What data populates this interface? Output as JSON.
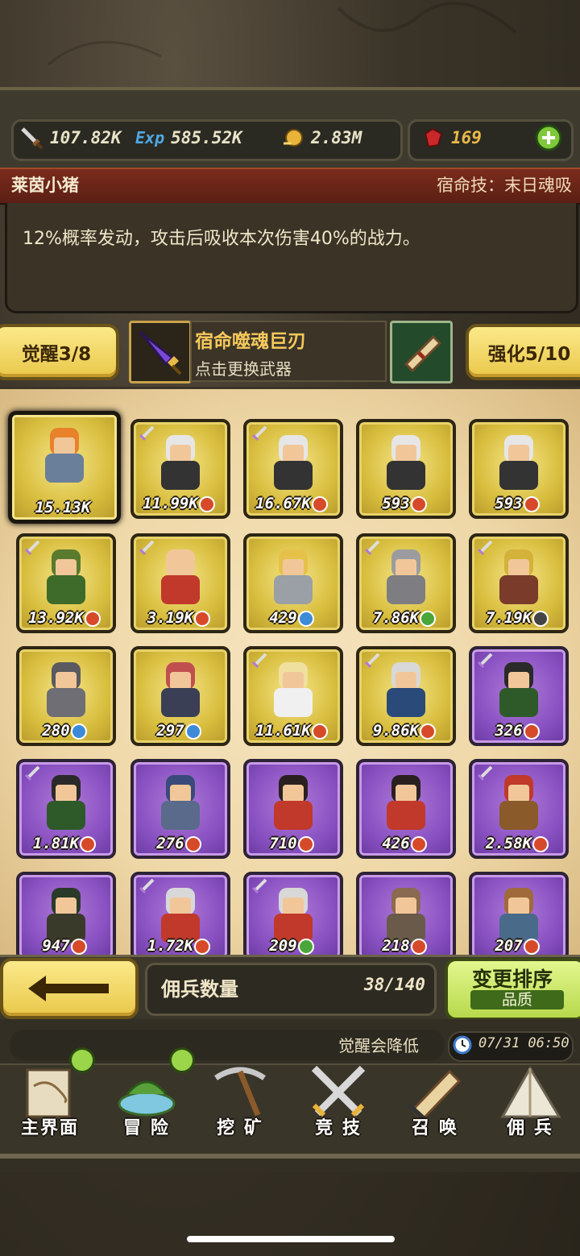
{
  "resources": {
    "attack": "107.82K",
    "exp_icon_label": "Exp",
    "exp": "585.52K",
    "gold": "2.83M",
    "gems": "169"
  },
  "hero": {
    "name": "莱茵小猪",
    "fate_skill": "宿命技：末日魂吸",
    "description": "12%概率发动，攻击后吸收本次伤害40%的战力。"
  },
  "weapon_row": {
    "awaken": "觉醒3/8",
    "weapon_name": "宿命噬魂巨刃",
    "weapon_hint": "点击更换武器",
    "enhance": "强化5/10"
  },
  "cards": [
    {
      "power": "15.13K",
      "tag": "",
      "rarity": "gold",
      "selected": true,
      "sword": false,
      "hair": "#e8822a",
      "body": "#6a7f9a"
    },
    {
      "power": "11.99K",
      "tag": "red",
      "rarity": "gold",
      "selected": false,
      "sword": true,
      "hair": "#e6e6e6",
      "body": "#333"
    },
    {
      "power": "16.67K",
      "tag": "red",
      "rarity": "gold",
      "selected": false,
      "sword": true,
      "hair": "#e6e6e6",
      "body": "#333"
    },
    {
      "power": "593",
      "tag": "red",
      "rarity": "gold",
      "selected": false,
      "sword": false,
      "hair": "#e6e6e6",
      "body": "#333"
    },
    {
      "power": "593",
      "tag": "red",
      "rarity": "gold",
      "selected": false,
      "sword": false,
      "hair": "#e6e6e6",
      "body": "#333"
    },
    {
      "power": "13.92K",
      "tag": "red",
      "rarity": "gold",
      "selected": false,
      "sword": true,
      "hair": "#5a7a2e",
      "body": "#3f6b2a"
    },
    {
      "power": "3.19K",
      "tag": "red",
      "rarity": "gold",
      "selected": false,
      "sword": true,
      "hair": "#f1c79a",
      "body": "#c0392b"
    },
    {
      "power": "429",
      "tag": "blue",
      "rarity": "gold",
      "selected": false,
      "sword": false,
      "hair": "#e6c14a",
      "body": "#9aa0a6"
    },
    {
      "power": "7.86K",
      "tag": "green",
      "rarity": "gold",
      "selected": false,
      "sword": true,
      "hair": "#9c9ca0",
      "body": "#7d7d82"
    },
    {
      "power": "7.19K",
      "tag": "dark",
      "rarity": "gold",
      "selected": false,
      "sword": true,
      "hair": "#d4b23a",
      "body": "#7a3b2a"
    },
    {
      "power": "280",
      "tag": "blue",
      "rarity": "gold",
      "selected": false,
      "sword": false,
      "hair": "#5a5a60",
      "body": "#6e6e74"
    },
    {
      "power": "297",
      "tag": "blue",
      "rarity": "gold",
      "selected": false,
      "sword": false,
      "hair": "#c05050",
      "body": "#3b3f55"
    },
    {
      "power": "11.61K",
      "tag": "red",
      "rarity": "gold",
      "selected": false,
      "sword": true,
      "hair": "#f0e0a0",
      "body": "#f0f0f0"
    },
    {
      "power": "9.86K",
      "tag": "red",
      "rarity": "gold",
      "selected": false,
      "sword": true,
      "hair": "#d8d8d8",
      "body": "#2a4a7a"
    },
    {
      "power": "326",
      "tag": "red",
      "rarity": "purple",
      "selected": false,
      "sword": true,
      "hair": "#2a2a2a",
      "body": "#2e5a2a"
    },
    {
      "power": "1.81K",
      "tag": "red",
      "rarity": "purple",
      "selected": false,
      "sword": true,
      "hair": "#2a2a2a",
      "body": "#2e5a2a"
    },
    {
      "power": "276",
      "tag": "red",
      "rarity": "purple",
      "selected": false,
      "sword": false,
      "hair": "#3a4a7a",
      "body": "#5a6a8a"
    },
    {
      "power": "710",
      "tag": "red",
      "rarity": "purple",
      "selected": false,
      "sword": false,
      "hair": "#2a2020",
      "body": "#c0392b"
    },
    {
      "power": "426",
      "tag": "red",
      "rarity": "purple",
      "selected": false,
      "sword": false,
      "hair": "#2a2020",
      "body": "#c0392b"
    },
    {
      "power": "2.58K",
      "tag": "red",
      "rarity": "purple",
      "selected": false,
      "sword": true,
      "hair": "#c0392b",
      "body": "#8a5a2a"
    },
    {
      "power": "947",
      "tag": "red",
      "rarity": "purple",
      "selected": false,
      "sword": false,
      "hair": "#2a3a2a",
      "body": "#3a3a2a"
    },
    {
      "power": "1.72K",
      "tag": "red",
      "rarity": "purple",
      "selected": false,
      "sword": true,
      "hair": "#d8d8d8",
      "body": "#c0392b"
    },
    {
      "power": "209",
      "tag": "green",
      "rarity": "purple",
      "selected": false,
      "sword": true,
      "hair": "#d8d8d8",
      "body": "#c0392b"
    },
    {
      "power": "218",
      "tag": "red",
      "rarity": "purple",
      "selected": false,
      "sword": false,
      "hair": "#8a6a50",
      "body": "#6a5a4a"
    },
    {
      "power": "207",
      "tag": "red",
      "rarity": "purple",
      "selected": false,
      "sword": false,
      "hair": "#a06a3a",
      "body": "#4a6a8a"
    }
  ],
  "merc_bar": {
    "count_label": "佣兵数量",
    "count_value": "38/140",
    "sort_title": "变更排序",
    "sort_sub": "品质"
  },
  "notice": {
    "text": "觉醒会降低",
    "time": "07/31 06:50"
  },
  "nav": {
    "items": [
      {
        "label": "主界面"
      },
      {
        "label": "冒 险"
      },
      {
        "label": "挖 矿"
      },
      {
        "label": "竞 技"
      },
      {
        "label": "召 唤"
      },
      {
        "label": "佣 兵"
      }
    ]
  },
  "colors": {
    "gold_card": "#d8be3e",
    "purple_card": "#8a52c2",
    "name_bar": "#7a2c1c",
    "sort_button": "#b7d94c"
  }
}
